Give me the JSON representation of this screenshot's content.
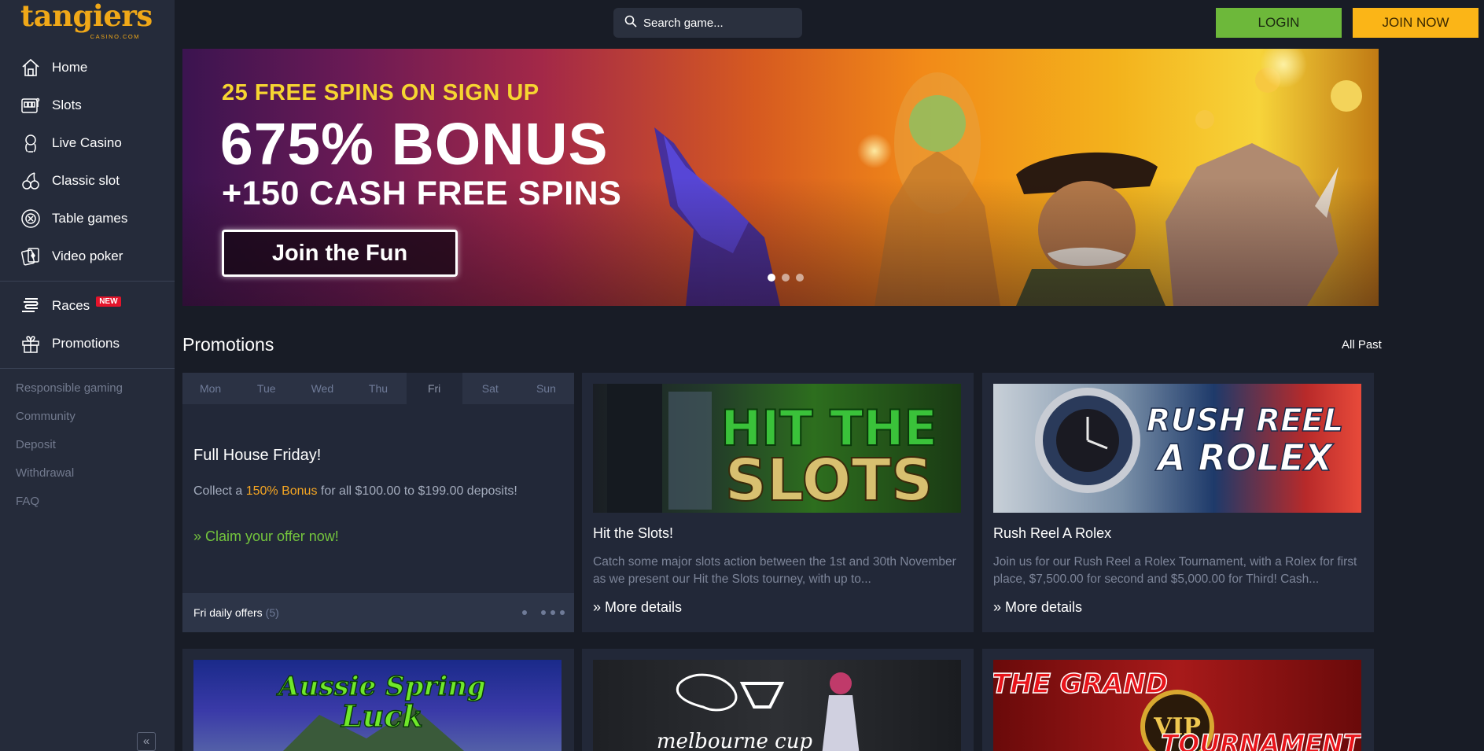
{
  "brand": {
    "name": "tangiers",
    "sub": "CASINO.COM"
  },
  "nav": {
    "items": [
      {
        "label": "Home",
        "icon": "home-icon"
      },
      {
        "label": "Slots",
        "icon": "slot-machine-icon"
      },
      {
        "label": "Live Casino",
        "icon": "dealer-icon"
      },
      {
        "label": "Classic slot",
        "icon": "cherries-icon"
      },
      {
        "label": "Table games",
        "icon": "chip-icon"
      },
      {
        "label": "Video poker",
        "icon": "cards-icon"
      }
    ],
    "races": {
      "label": "Races",
      "badge": "NEW"
    },
    "promotions": {
      "label": "Promotions"
    },
    "links": [
      "Responsible gaming",
      "Community",
      "Deposit",
      "Withdrawal",
      "FAQ"
    ],
    "collapse": "«"
  },
  "topbar": {
    "search_placeholder": "Search game...",
    "login": "LOGIN",
    "join": "JOIN NOW"
  },
  "hero": {
    "line1": "25 FREE SPINS ON SIGN UP",
    "line2": "675% BONUS",
    "line3": "+150 CASH FREE SPINS",
    "cta": "Join the Fun",
    "slides": 3,
    "active_slide": 1
  },
  "promotions": {
    "title": "Promotions",
    "all_past": "All Past",
    "daily": {
      "days": [
        "Mon",
        "Tue",
        "Wed",
        "Thu",
        "Fri",
        "Sat",
        "Sun"
      ],
      "active_day": "Fri",
      "title": "Full House Friday!",
      "desc_prefix": "Collect a ",
      "desc_highlight": "150% Bonus",
      "desc_suffix": " for all $100.00 to $199.00 deposits!",
      "claim": "» Claim your offer now!",
      "footer_label": "Fri daily offers",
      "footer_count": "(5)"
    },
    "cards": [
      {
        "image_text": "HIT THE SLOTS",
        "title": "Hit the Slots!",
        "desc": "Catch some major slots action between the 1st and 30th November as we present our Hit the Slots tourney, with up to...",
        "more": "»  More details"
      },
      {
        "image_text": "RUSH REEL A ROLEX",
        "title": "Rush Reel A Rolex",
        "desc": "Join us for our Rush Reel a Rolex Tournament, with a Rolex for first place, $7,500.00 for second and $5,000.00 for Third! Cash...",
        "more": "»  More details"
      }
    ],
    "row2": [
      {
        "image_text": "Aussie Spring Luck"
      },
      {
        "image_text": "melbourne cup"
      },
      {
        "image_text": "THE GRAND VIP TOURNAMENT"
      }
    ]
  },
  "colors": {
    "bg": "#181c26",
    "sidebar": "#252b3a",
    "card": "#222838",
    "brand": "#f0a818",
    "login": "#6db83a",
    "join": "#fbb517",
    "accent_green": "#74c53d",
    "highlight": "#f5a623"
  }
}
